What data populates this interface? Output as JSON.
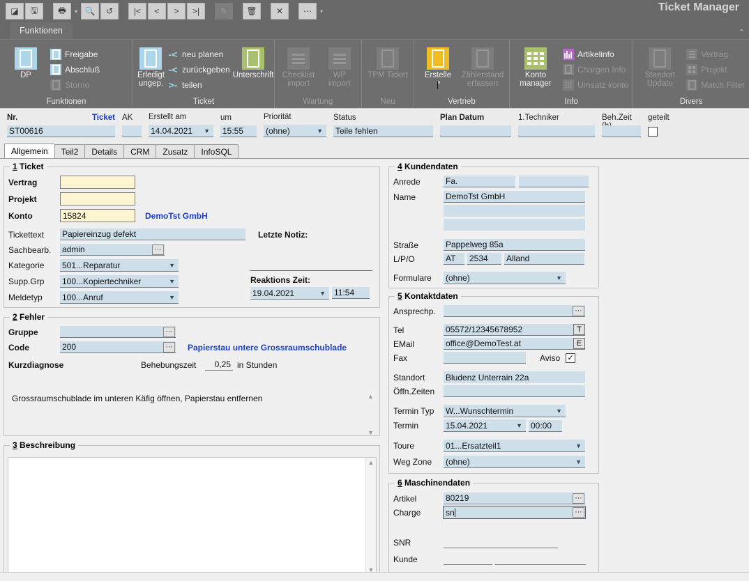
{
  "app": {
    "title": "Ticket Manager"
  },
  "quick_access": {
    "buttons": [
      {
        "name": "edit-toggle-icon",
        "glyph": "◪",
        "disabled": false
      },
      {
        "name": "save-icon",
        "glyph": "🖫",
        "disabled": false
      },
      {
        "name": "print-icon",
        "glyph": "🖶",
        "disabled": false
      },
      {
        "name": "print-dropdown-caret",
        "glyph": "▾",
        "disabled": false
      },
      {
        "name": "search-icon",
        "glyph": "🔍",
        "disabled": false
      },
      {
        "name": "refresh-icon",
        "glyph": "↺",
        "disabled": false
      },
      {
        "name": "first-record-icon",
        "glyph": "|<",
        "disabled": false
      },
      {
        "name": "previous-record-icon",
        "glyph": "<",
        "disabled": false
      },
      {
        "name": "next-record-icon",
        "glyph": ">",
        "disabled": false
      },
      {
        "name": "last-record-icon",
        "glyph": ">|",
        "disabled": false
      },
      {
        "name": "pencil-edit-icon",
        "glyph": "✎",
        "disabled": true
      },
      {
        "name": "delete-icon",
        "glyph": "🗑",
        "disabled": false
      },
      {
        "name": "cancel-icon",
        "glyph": "✕",
        "disabled": false
      },
      {
        "name": "more-icon",
        "glyph": "⋯",
        "disabled": false
      },
      {
        "name": "more-dropdown-caret",
        "glyph": "▾",
        "disabled": false
      }
    ]
  },
  "ribbon": {
    "tab": "Funktionen",
    "collapse_icon": "⌃",
    "groups": [
      {
        "name": "funktionen",
        "label": "Funktionen",
        "label_dim": false,
        "big": [
          {
            "label": "DP",
            "icon": "document-icon",
            "color": "blue",
            "disabled": false,
            "caret": false
          }
        ],
        "small": [
          {
            "label": "Freigabe",
            "icon": "checkbox-blue-icon",
            "disabled": false
          },
          {
            "label": "Abschluß",
            "icon": "checkbox-blue-icon",
            "disabled": false
          },
          {
            "label": "Storno",
            "icon": "checkbox-grey-icon",
            "disabled": true
          }
        ]
      },
      {
        "name": "ticket",
        "label": "Ticket",
        "label_dim": false,
        "big": [
          {
            "label": "Erledigt ungep.",
            "icon": "document-icon",
            "color": "blue",
            "disabled": false,
            "caret": false
          }
        ],
        "small": [
          {
            "label": "neu planen",
            "icon": "reschedule-arrow-icon",
            "disabled": false
          },
          {
            "label": "zurückgeben",
            "icon": "return-arrow-icon",
            "disabled": false
          },
          {
            "label": "teilen",
            "icon": "split-arrow-icon",
            "disabled": false
          }
        ],
        "big2": [
          {
            "label": "Unterschrift",
            "icon": "signature-document-icon",
            "color": "green",
            "disabled": false,
            "caret": false
          }
        ]
      },
      {
        "name": "wartung",
        "label": "Wartung",
        "label_dim": true,
        "big": [
          {
            "label": "Checklist import",
            "icon": "lines-icon",
            "color": "grey",
            "disabled": true,
            "caret": false
          },
          {
            "label": "WP import",
            "icon": "lines-icon",
            "color": "grey",
            "disabled": true,
            "caret": false
          }
        ],
        "small": []
      },
      {
        "name": "neu",
        "label": "Neu",
        "label_dim": true,
        "big": [
          {
            "label": "TPM Ticket",
            "icon": "document-icon",
            "color": "grey",
            "disabled": true,
            "caret": false
          }
        ],
        "small": []
      },
      {
        "name": "vertrieb",
        "label": "Vertrieb",
        "label_dim": false,
        "big": [
          {
            "label": "Erstelle",
            "icon": "document-icon",
            "color": "gold",
            "disabled": false,
            "caret": true
          },
          {
            "label": "Zählerstand erfassen",
            "icon": "document-icon",
            "color": "grey",
            "disabled": true,
            "caret": false
          }
        ],
        "small": []
      },
      {
        "name": "info",
        "label": "Info",
        "label_dim": false,
        "big": [
          {
            "label": "Konto manager",
            "icon": "grid-green-icon",
            "color": "green-grid",
            "disabled": false,
            "caret": false
          }
        ],
        "small": [
          {
            "label": "Artikelinfo",
            "icon": "bar-chart-icon",
            "disabled": false
          },
          {
            "label": "Chargen Info",
            "icon": "batch-icon",
            "disabled": true
          },
          {
            "label": "Umsatz konto",
            "icon": "dots-grid-icon",
            "disabled": true
          }
        ]
      },
      {
        "name": "divers",
        "label": "Divers",
        "label_dim": false,
        "big": [
          {
            "label": "Standort Update",
            "icon": "document-icon",
            "color": "grey",
            "disabled": true,
            "caret": false
          }
        ],
        "small": [
          {
            "label": "Vertrag",
            "icon": "contract-icon",
            "disabled": true
          },
          {
            "label": "Projekt",
            "icon": "project-squares-icon",
            "disabled": true
          },
          {
            "label": "Match Filter",
            "icon": "filter-box-icon",
            "disabled": true
          }
        ]
      }
    ]
  },
  "header": {
    "nr_label": "Nr.",
    "nr_value": "ST00616",
    "ticket_link": "Ticket",
    "ak_label": "AK",
    "ak_value": "",
    "erstellt_label": "Erstellt am",
    "erstellt_value": "14.04.2021",
    "um_label": "um",
    "um_value": "15:55",
    "prio_label": "Priorität",
    "prio_value": "(ohne)",
    "status_label": "Status",
    "status_value": "Teile fehlen",
    "plan_label": "Plan Datum",
    "plan_value": "",
    "techniker_label": "1.Techniker",
    "techniker_value": "",
    "behzeit_label": "Beh.Zeit (h)",
    "behzeit_value": "",
    "geteilt_label": "geteilt",
    "geteilt_checked": false
  },
  "tabs": [
    {
      "label": "Allgemein",
      "active": true
    },
    {
      "label": "Teil2",
      "active": false
    },
    {
      "label": "Details",
      "active": false
    },
    {
      "label": "CRM",
      "active": false
    },
    {
      "label": "Zusatz",
      "active": false
    },
    {
      "label": "InfoSQL",
      "active": false
    }
  ],
  "ticket_section": {
    "num": "1",
    "title": " Ticket",
    "vertrag_label": "Vertrag",
    "vertrag_value": "",
    "projekt_label": "Projekt",
    "projekt_value": "",
    "konto_label": "Konto",
    "konto_value": "15824",
    "konto_name": "DemoTst GmbH",
    "tickettext_label": "Tickettext",
    "tickettext_value": "Papiereinzug defekt",
    "sachbearb_label": "Sachbearb.",
    "sachbearb_value": "admin",
    "kategorie_label": "Kategorie",
    "kategorie_value": "501...Reparatur",
    "suppgrp_label": "Supp.Grp",
    "suppgrp_value": "100...Kopiertechniker",
    "meldetyp_label": "Meldetyp",
    "meldetyp_value": "100...Anruf",
    "letzte_notiz_label": "Letzte Notiz:",
    "letzte_notiz_value": "",
    "reaktions_label": "Reaktions Zeit:",
    "reaktions_date": "19.04.2021",
    "reaktions_time": "11:54"
  },
  "fehler_section": {
    "num": "2",
    "title": " Fehler",
    "gruppe_label": "Gruppe",
    "gruppe_value": "",
    "code_label": "Code",
    "code_value": "200",
    "code_text": "Papierstau untere Grossraumschublade",
    "kurzdiagnose_label": "Kurzdiagnose",
    "behebungszeit_label": "Behebungszeit",
    "behebungszeit_value": "0,25",
    "stunden_label": "in Stunden",
    "diagnose_text": "Grossraumschublade im unteren Käfig öffnen, Papierstau entfernen"
  },
  "beschreibung_section": {
    "num": "3",
    "title": " Beschreibung",
    "text": ""
  },
  "kundendaten_section": {
    "num": "4",
    "title": " Kundendaten",
    "anrede_label": "Anrede",
    "anrede_value": "Fa.",
    "anrede_value2": "",
    "name_label": "Name",
    "name1": "DemoTst GmbH",
    "name2": "",
    "name3": "",
    "strasse_label": "Straße",
    "strasse_value": "Pappelweg 85a",
    "lpo_label": "L/P/O",
    "land": "AT",
    "plz": "2534",
    "ort": "Alland",
    "formulare_label": "Formulare",
    "formulare_value": "(ohne)"
  },
  "kontaktdaten_section": {
    "num": "5",
    "title": " Kontaktdaten",
    "ansprechp_label": "Ansprechp.",
    "ansprechp_value": "",
    "tel_label": "Tel",
    "tel_value": "05572/12345678952",
    "tel_button": "T",
    "email_label": "EMail",
    "email_value": "office@DemoTest.at",
    "email_button": "E",
    "fax_label": "Fax",
    "fax_value": "",
    "aviso_label": "Aviso",
    "aviso_checked": true,
    "standort_label": "Standort",
    "standort_value": "Bludenz Unterrain 22a",
    "oeffnzeiten_label": "Öffn.Zeiten",
    "oeffnzeiten_value": "",
    "termintyp_label": "Termin Typ",
    "termintyp_value": "W...Wunschtermin",
    "termin_label": "Termin",
    "termin_date": "15.04.2021",
    "termin_time": "00:00",
    "toure_label": "Toure",
    "toure_value": "01...Ersatzteil1",
    "wegzone_label": "Weg Zone",
    "wegzone_value": "(ohne)"
  },
  "maschinendaten_section": {
    "num": "6",
    "title": " Maschinendaten",
    "artikel_label": "Artikel",
    "artikel_value": "80219",
    "charge_label": "Charge",
    "charge_value": "sn",
    "snr_label": "SNR",
    "snr_value": "",
    "kunde_label": "Kunde",
    "kunde_value": "",
    "kunde_value2": ""
  },
  "colors": {
    "chrome": "#686868",
    "ribbon": "#6e6e6e",
    "field_blue": "#cfdfea",
    "field_yellow": "#fdf4d2",
    "link_blue": "#1b3fcc",
    "accent_gold": "#f0bd24",
    "accent_green": "#a9c16f",
    "accent_purple": "#b766c9",
    "icon_blue": "#aed6ea"
  }
}
